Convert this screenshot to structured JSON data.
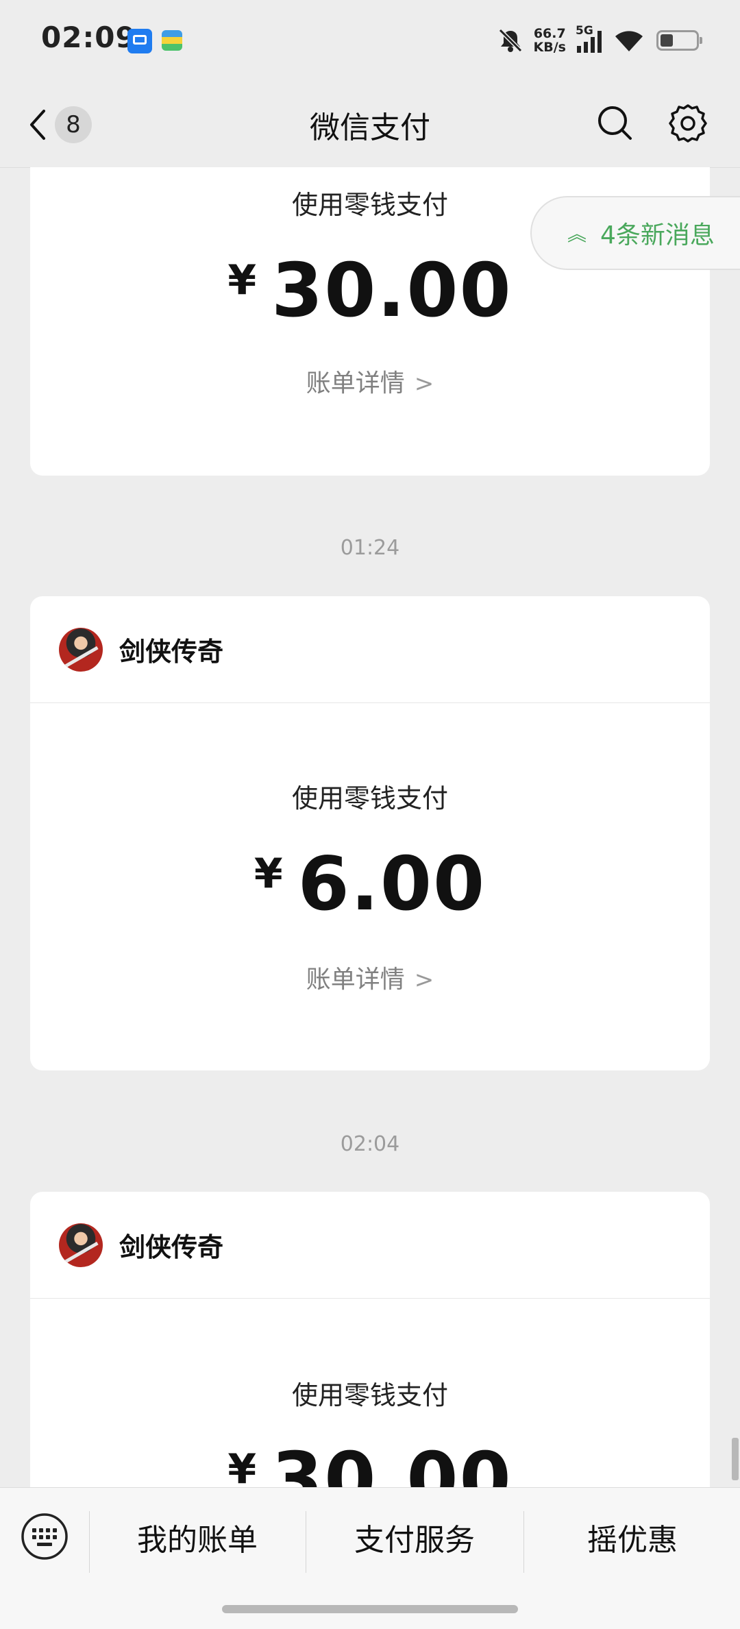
{
  "status_bar": {
    "time": "02:09",
    "net_speed_value": "66.7",
    "net_speed_unit": "KB/s",
    "network": "5G"
  },
  "nav": {
    "back_badge": "8",
    "title": "微信支付"
  },
  "new_messages": "4条新消息",
  "cards": [
    {
      "pay_method": "使用零钱支付",
      "currency": "¥",
      "amount": "30.00",
      "bill_link": "账单详情"
    },
    {
      "merchant": "剑侠传奇",
      "pay_method": "使用零钱支付",
      "currency": "¥",
      "amount": "6.00",
      "bill_link": "账单详情"
    },
    {
      "merchant": "剑侠传奇",
      "pay_method": "使用零钱支付",
      "currency": "¥",
      "amount": "30.00"
    }
  ],
  "timestamps": [
    "01:24",
    "02:04"
  ],
  "bottom_menu": {
    "bill": "我的账单",
    "services": "支付服务",
    "discount": "摇优惠"
  },
  "icons": {
    "back": "chevron-left-icon",
    "search": "search-icon",
    "settings": "gear-icon",
    "keyboard": "keyboard-icon",
    "bell_muted": "bell-off-icon",
    "signal": "signal-icon",
    "wifi": "wifi-icon",
    "battery": "battery-icon"
  },
  "colors": {
    "accent_green": "#4aa85c",
    "background": "#ededed"
  }
}
